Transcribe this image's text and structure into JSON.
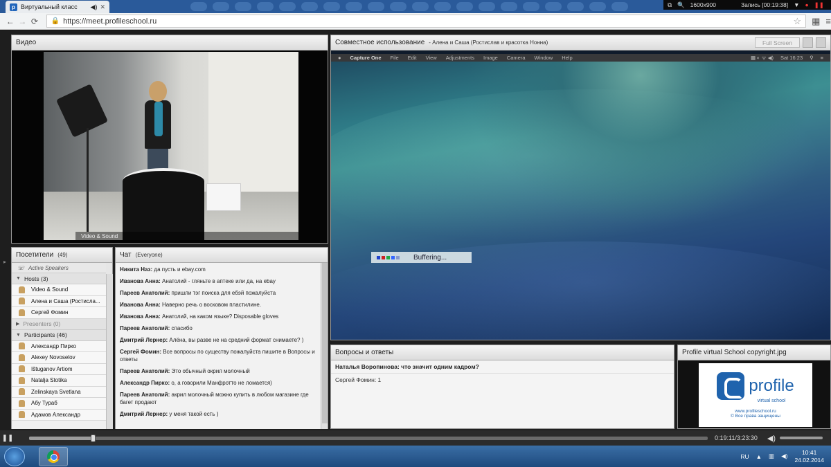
{
  "browser": {
    "tab_title": "Виртуальный класс",
    "url": "https://meet.profileschool.ru"
  },
  "recorder": {
    "resolution": "1600x900",
    "record_label": "Запись [00:19:38]"
  },
  "video": {
    "title": "Видео",
    "caption": "Video & Sound"
  },
  "share": {
    "title": "Совместное использование",
    "subtitle": "- Алена и Саша (Ростислав и красотка Нонна)",
    "fullscreen_label": "Full Screen",
    "mac_menu": [
      "Capture One",
      "File",
      "Edit",
      "View",
      "Adjustments",
      "Image",
      "Camera",
      "Window",
      "Help"
    ],
    "mac_clock": "Sat 16:23",
    "buffering_text": "Buffering...",
    "buffer_dot_colors": [
      "#2244cc",
      "#cc2222",
      "#22aa44",
      "#3366ff",
      "#8899cc"
    ]
  },
  "attendees": {
    "title": "Посетители",
    "count": "(49)",
    "active_speakers": "Active Speakers",
    "hosts_label": "Hosts (3)",
    "hosts": [
      "Video & Sound",
      "Алена и Саша (Ростисла...",
      "Сергей Фомин"
    ],
    "presenters_label": "Presenters (0)",
    "participants_label": "Participants (46)",
    "participants": [
      "Александр Пирко",
      "Alexey Novoselov",
      "Ištuganov Artiom",
      "Natalja Stotika",
      "Zelinskaya Svetlana",
      "Абу Тураб",
      "Адамов Александр"
    ]
  },
  "chat": {
    "title": "Чат",
    "scope": "(Everyone)",
    "messages": [
      {
        "author": "Никита Наз:",
        "text": " да пусть и ebay.com"
      },
      {
        "author": "Иванова Анна:",
        "text": " Анатолий - гляньте в аптеке или да, на ebay"
      },
      {
        "author": "Пареев Анатолий:",
        "text": " пришли тэг поиска для ебэй пожалуйста"
      },
      {
        "author": "Иванова Анна:",
        "text": " Наверно речь о восковом пластилине."
      },
      {
        "author": "Иванова Анна:",
        "text": " Анатолий, на каком языке? Disposable gloves"
      },
      {
        "author": "Пареев Анатолий:",
        "text": " спасибо"
      },
      {
        "author": "Дмитрий Лернер:",
        "text": " Алёна, вы разве не на средний формат снимаете? )"
      },
      {
        "author": "Сергей Фомин:",
        "text": " Все вопросы по существу пожалуйста пишите в Вопросы и ответы"
      },
      {
        "author": "Пареев Анатолий:",
        "text": " Это обычный окрил молочный"
      },
      {
        "author": "Александр Пирко:",
        "text": " о, а говорили Манфротто не ломается)"
      },
      {
        "author": "Пареев Анатолий:",
        "text": " акрил молочный можно купить в любом магазине где багет продают"
      },
      {
        "author": "Дмитрий Лернер:",
        "text": " у меня такой есть )"
      }
    ]
  },
  "qa": {
    "title": "Вопросы и ответы",
    "question": "Наталья Воропинова: что значит одним кадром?",
    "answer": "Сергей Фомин: 1"
  },
  "file": {
    "title": "Profile virtual School copyright.jpg",
    "logo_word": "profile",
    "logo_sub": "virtual school",
    "logo_url": "www.profileschool.ru",
    "logo_copyright": "© Все права защищены"
  },
  "player": {
    "time": "0:19:11/3:23:30",
    "progress": 0.094
  },
  "taskbar": {
    "lang": "RU",
    "time": "10:41",
    "date": "24.02.2014"
  }
}
